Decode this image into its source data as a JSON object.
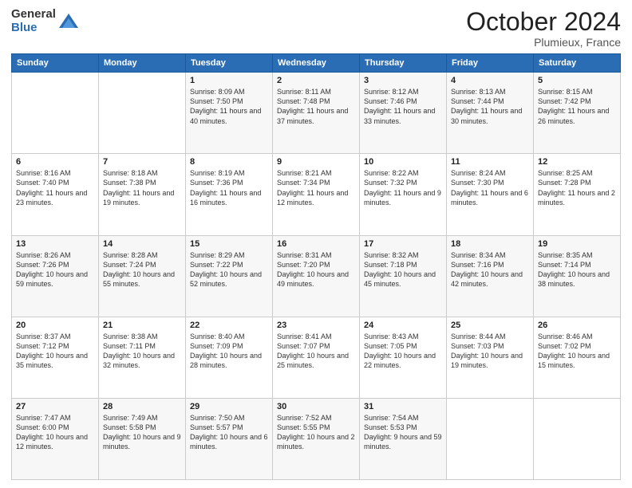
{
  "logo": {
    "general": "General",
    "blue": "Blue"
  },
  "header": {
    "month": "October 2024",
    "location": "Plumieux, France"
  },
  "days_of_week": [
    "Sunday",
    "Monday",
    "Tuesday",
    "Wednesday",
    "Thursday",
    "Friday",
    "Saturday"
  ],
  "weeks": [
    [
      {
        "day": "",
        "info": ""
      },
      {
        "day": "",
        "info": ""
      },
      {
        "day": "1",
        "info": "Sunrise: 8:09 AM\nSunset: 7:50 PM\nDaylight: 11 hours and 40 minutes."
      },
      {
        "day": "2",
        "info": "Sunrise: 8:11 AM\nSunset: 7:48 PM\nDaylight: 11 hours and 37 minutes."
      },
      {
        "day": "3",
        "info": "Sunrise: 8:12 AM\nSunset: 7:46 PM\nDaylight: 11 hours and 33 minutes."
      },
      {
        "day": "4",
        "info": "Sunrise: 8:13 AM\nSunset: 7:44 PM\nDaylight: 11 hours and 30 minutes."
      },
      {
        "day": "5",
        "info": "Sunrise: 8:15 AM\nSunset: 7:42 PM\nDaylight: 11 hours and 26 minutes."
      }
    ],
    [
      {
        "day": "6",
        "info": "Sunrise: 8:16 AM\nSunset: 7:40 PM\nDaylight: 11 hours and 23 minutes."
      },
      {
        "day": "7",
        "info": "Sunrise: 8:18 AM\nSunset: 7:38 PM\nDaylight: 11 hours and 19 minutes."
      },
      {
        "day": "8",
        "info": "Sunrise: 8:19 AM\nSunset: 7:36 PM\nDaylight: 11 hours and 16 minutes."
      },
      {
        "day": "9",
        "info": "Sunrise: 8:21 AM\nSunset: 7:34 PM\nDaylight: 11 hours and 12 minutes."
      },
      {
        "day": "10",
        "info": "Sunrise: 8:22 AM\nSunset: 7:32 PM\nDaylight: 11 hours and 9 minutes."
      },
      {
        "day": "11",
        "info": "Sunrise: 8:24 AM\nSunset: 7:30 PM\nDaylight: 11 hours and 6 minutes."
      },
      {
        "day": "12",
        "info": "Sunrise: 8:25 AM\nSunset: 7:28 PM\nDaylight: 11 hours and 2 minutes."
      }
    ],
    [
      {
        "day": "13",
        "info": "Sunrise: 8:26 AM\nSunset: 7:26 PM\nDaylight: 10 hours and 59 minutes."
      },
      {
        "day": "14",
        "info": "Sunrise: 8:28 AM\nSunset: 7:24 PM\nDaylight: 10 hours and 55 minutes."
      },
      {
        "day": "15",
        "info": "Sunrise: 8:29 AM\nSunset: 7:22 PM\nDaylight: 10 hours and 52 minutes."
      },
      {
        "day": "16",
        "info": "Sunrise: 8:31 AM\nSunset: 7:20 PM\nDaylight: 10 hours and 49 minutes."
      },
      {
        "day": "17",
        "info": "Sunrise: 8:32 AM\nSunset: 7:18 PM\nDaylight: 10 hours and 45 minutes."
      },
      {
        "day": "18",
        "info": "Sunrise: 8:34 AM\nSunset: 7:16 PM\nDaylight: 10 hours and 42 minutes."
      },
      {
        "day": "19",
        "info": "Sunrise: 8:35 AM\nSunset: 7:14 PM\nDaylight: 10 hours and 38 minutes."
      }
    ],
    [
      {
        "day": "20",
        "info": "Sunrise: 8:37 AM\nSunset: 7:12 PM\nDaylight: 10 hours and 35 minutes."
      },
      {
        "day": "21",
        "info": "Sunrise: 8:38 AM\nSunset: 7:11 PM\nDaylight: 10 hours and 32 minutes."
      },
      {
        "day": "22",
        "info": "Sunrise: 8:40 AM\nSunset: 7:09 PM\nDaylight: 10 hours and 28 minutes."
      },
      {
        "day": "23",
        "info": "Sunrise: 8:41 AM\nSunset: 7:07 PM\nDaylight: 10 hours and 25 minutes."
      },
      {
        "day": "24",
        "info": "Sunrise: 8:43 AM\nSunset: 7:05 PM\nDaylight: 10 hours and 22 minutes."
      },
      {
        "day": "25",
        "info": "Sunrise: 8:44 AM\nSunset: 7:03 PM\nDaylight: 10 hours and 19 minutes."
      },
      {
        "day": "26",
        "info": "Sunrise: 8:46 AM\nSunset: 7:02 PM\nDaylight: 10 hours and 15 minutes."
      }
    ],
    [
      {
        "day": "27",
        "info": "Sunrise: 7:47 AM\nSunset: 6:00 PM\nDaylight: 10 hours and 12 minutes."
      },
      {
        "day": "28",
        "info": "Sunrise: 7:49 AM\nSunset: 5:58 PM\nDaylight: 10 hours and 9 minutes."
      },
      {
        "day": "29",
        "info": "Sunrise: 7:50 AM\nSunset: 5:57 PM\nDaylight: 10 hours and 6 minutes."
      },
      {
        "day": "30",
        "info": "Sunrise: 7:52 AM\nSunset: 5:55 PM\nDaylight: 10 hours and 2 minutes."
      },
      {
        "day": "31",
        "info": "Sunrise: 7:54 AM\nSunset: 5:53 PM\nDaylight: 9 hours and 59 minutes."
      },
      {
        "day": "",
        "info": ""
      },
      {
        "day": "",
        "info": ""
      }
    ]
  ]
}
